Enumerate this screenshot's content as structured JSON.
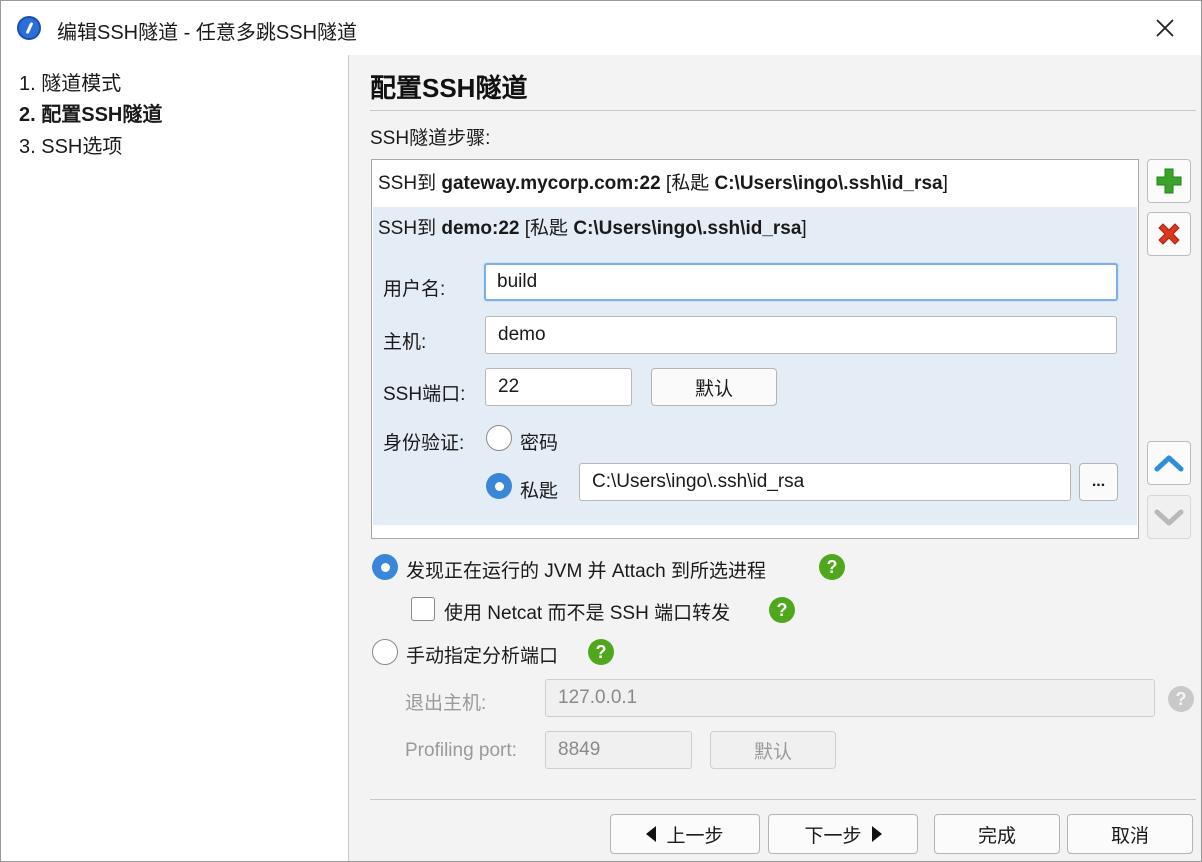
{
  "window": {
    "title": "编辑SSH隧道 - 任意多跳SSH隧道"
  },
  "sidebar": {
    "steps": [
      "1. 隧道模式",
      "2. 配置SSH隧道",
      "3. SSH选项"
    ]
  },
  "main": {
    "heading": "配置SSH隧道",
    "steps_label": "SSH隧道步骤:",
    "hops": [
      {
        "prefix": "SSH到 ",
        "host": "gateway.mycorp.com:22",
        "mid": " [私匙 ",
        "key": "C:\\Users\\ingo\\.ssh\\id_rsa",
        "suffix": "]"
      },
      {
        "prefix": "SSH到 ",
        "host": "demo:22",
        "mid": " [私匙 ",
        "key": "C:\\Users\\ingo\\.ssh\\id_rsa",
        "suffix": "]"
      }
    ],
    "form": {
      "username_label": "用户名:",
      "username_value": "build",
      "host_label": "主机:",
      "host_value": "demo",
      "port_label": "SSH端口:",
      "port_value": "22",
      "default_label": "默认",
      "auth_label": "身份验证:",
      "auth_password": "密码",
      "auth_key": "私匙",
      "key_path": "C:\\Users\\ingo\\.ssh\\id_rsa",
      "browse_label": "..."
    },
    "options": {
      "discover_label": "发现正在运行的 JVM 并 Attach 到所选进程",
      "netcat_label": "使用 Netcat 而不是 SSH 端口转发",
      "manual_label": "手动指定分析端口",
      "exit_host_label": "退出主机:",
      "exit_host_value": "127.0.0.1",
      "profiling_port_label": "Profiling port:",
      "profiling_port_value": "8849",
      "default_label": "默认",
      "help_glyph": "?"
    }
  },
  "nav": {
    "back": "上一步",
    "next": "下一步",
    "finish": "完成",
    "cancel": "取消"
  },
  "colors": {
    "accent": "#3a86d8",
    "add": "#3aa32a",
    "remove": "#d9381e",
    "help": "#4fa81c",
    "selection": "#e4ecf5"
  },
  "icons": {
    "add": "plus-icon",
    "remove": "x-icon",
    "up": "chevron-up-icon",
    "down": "chevron-down-icon",
    "close": "close-icon",
    "help": "question-icon"
  }
}
